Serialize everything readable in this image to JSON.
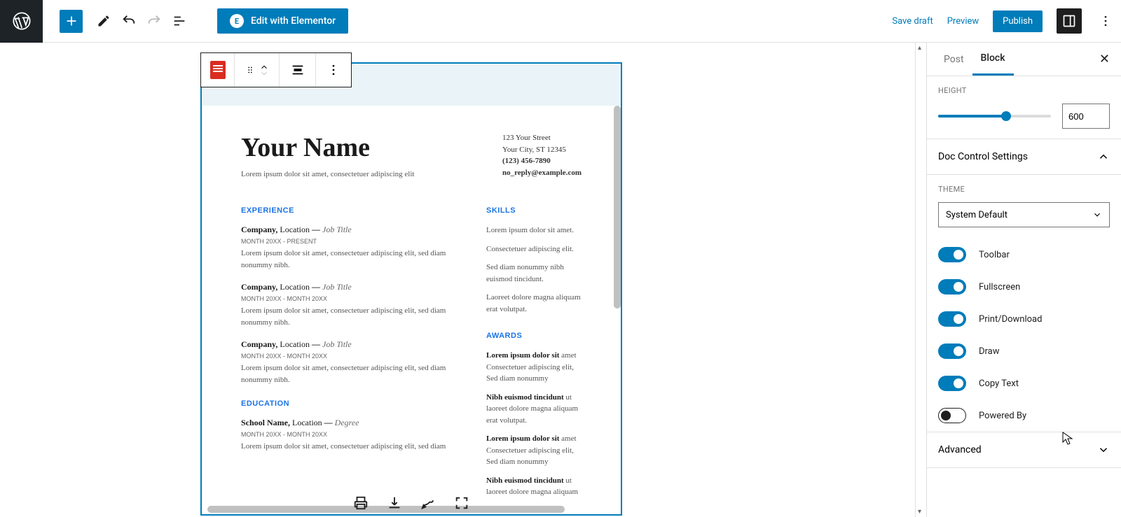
{
  "topbar": {
    "elementor_label": "Edit with Elementor",
    "save_draft": "Save draft",
    "preview": "Preview",
    "publish": "Publish"
  },
  "sidebar": {
    "tabs": {
      "post": "Post",
      "block": "Block"
    },
    "height": {
      "label": "HEIGHT",
      "value": "600"
    },
    "doc_control": {
      "title": "Doc Control Settings"
    },
    "theme": {
      "label": "THEME",
      "selected": "System Default"
    },
    "toggles": {
      "toolbar": "Toolbar",
      "fullscreen": "Fullscreen",
      "print_download": "Print/Download",
      "draw": "Draw",
      "copy_text": "Copy Text",
      "powered_by": "Powered By"
    },
    "advanced": "Advanced"
  },
  "doc": {
    "name": "Your Name",
    "tagline": "Lorem ipsum dolor sit amet, consectetuer adipiscing elit",
    "contact": {
      "street": "123 Your Street",
      "city": "Your City, ST 12345",
      "phone": "(123) 456-7890",
      "email": "no_reply@example.com"
    },
    "sections": {
      "experience": "EXPERIENCE",
      "skills": "SKILLS",
      "awards": "AWARDS",
      "education": "EDUCATION"
    },
    "jobs": [
      {
        "company": "Company,",
        "location": " Location",
        "dash": " — ",
        "role": "Job Title",
        "dates": "MONTH 20XX - PRESENT",
        "desc": "Lorem ipsum dolor sit amet, consectetuer adipiscing elit, sed diam nonummy nibh."
      },
      {
        "company": "Company,",
        "location": " Location",
        "dash": " — ",
        "role": "Job Title",
        "dates": "MONTH 20XX - MONTH 20XX",
        "desc": "Lorem ipsum dolor sit amet, consectetuer adipiscing elit, sed diam nonummy nibh."
      },
      {
        "company": "Company,",
        "location": " Location",
        "dash": " — ",
        "role": "Job Title",
        "dates": "MONTH 20XX - MONTH 20XX",
        "desc": "Lorem ipsum dolor sit amet, consectetuer adipiscing elit, sed diam nonummy nibh."
      }
    ],
    "education": {
      "school": "School Name,",
      "loc": " Location",
      "dash": " — ",
      "degree": "Degree",
      "dates": "MONTH 20XX - MONTH 20XX",
      "desc": "Lorem ipsum dolor sit amet, consectetuer adipiscing elit, sed diam"
    },
    "skills": [
      "Lorem ipsum dolor sit amet.",
      "Consectetuer adipiscing elit.",
      "Sed diam nonummy nibh euismod tincidunt.",
      "Laoreet dolore magna aliquam erat volutpat."
    ],
    "awards": [
      {
        "t": "Lorem ipsum dolor sit",
        "r": " amet Consectetuer adipiscing elit, Sed diam nonummy"
      },
      {
        "t": "Nibh euismod tincidunt",
        "r": " ut laoreet dolore magna aliquam erat volutpat."
      },
      {
        "t": "Lorem ipsum dolor sit",
        "r": " amet Consectetuer adipiscing elit, Sed diam nonummy"
      },
      {
        "t": "Nibh euismod tincidunt",
        "r": " ut laoreet dolore magna aliquam"
      }
    ]
  }
}
